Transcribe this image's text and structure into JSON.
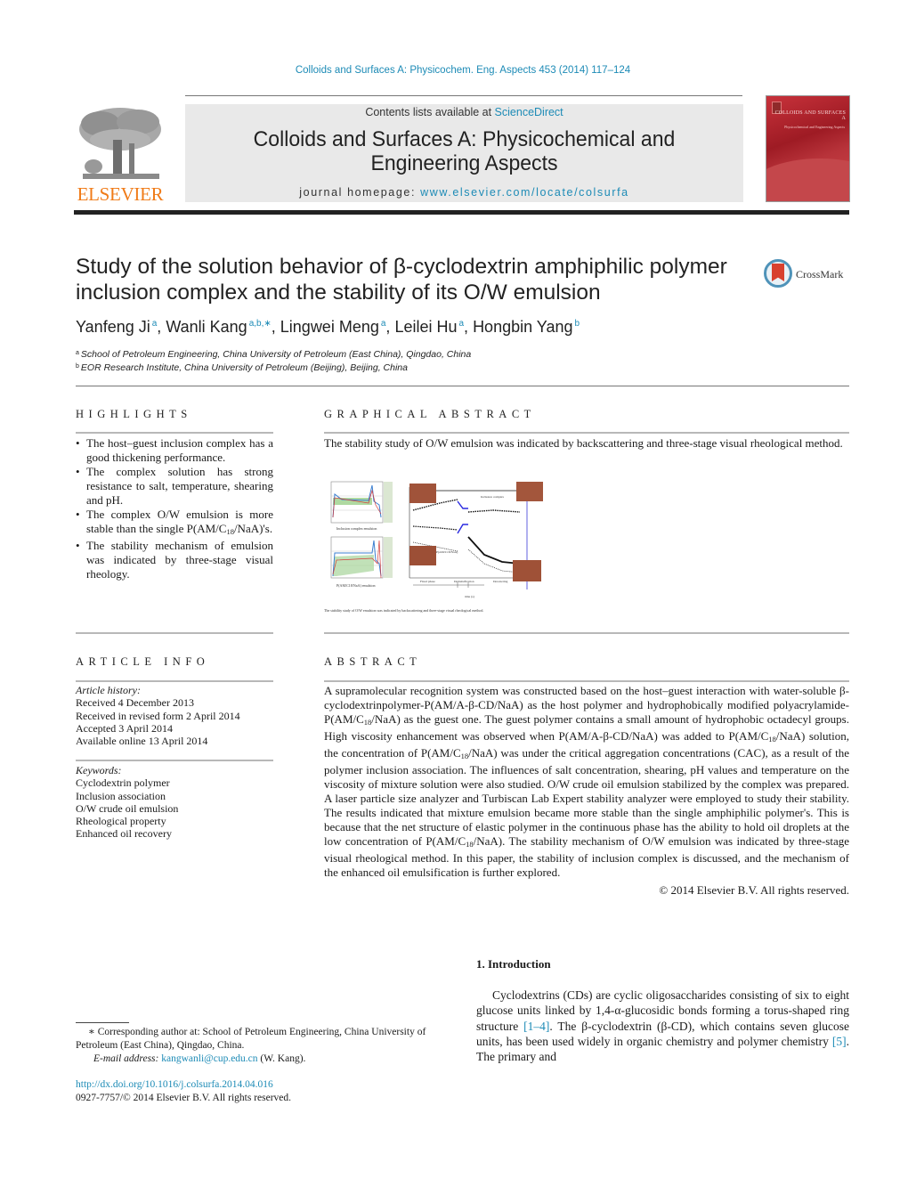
{
  "header": {
    "journal_ref": "Colloids and Surfaces A: Physicochem. Eng. Aspects 453 (2014) 117–124",
    "contents_prefix": "Contents lists available at ",
    "contents_link": "ScienceDirect",
    "journal_title_line1": "Colloids and Surfaces A: Physicochemical and",
    "journal_title_line2": "Engineering Aspects",
    "homepage_prefix": "journal homepage: ",
    "homepage_link": "www.elsevier.com/locate/colsurfa",
    "publisher_logo_text": "ELSEVIER",
    "cover_title": "COLLOIDS AND SURFACES A",
    "cover_subtitle": "Physicochemical and Engineering Aspects"
  },
  "article": {
    "title": "Study of the solution behavior of β-cyclodextrin amphiphilic polymer inclusion complex and the stability of its O/W emulsion",
    "crossmark_label": "CrossMark",
    "authors": [
      {
        "name": "Yanfeng Ji",
        "sup": "a"
      },
      {
        "name": "Wanli Kang",
        "sup": "a,b,∗"
      },
      {
        "name": "Lingwei Meng",
        "sup": "a"
      },
      {
        "name": "Leilei Hu",
        "sup": "a"
      },
      {
        "name": "Hongbin Yang",
        "sup": "b"
      }
    ],
    "affiliations": [
      {
        "sup": "a",
        "text": "School of Petroleum Engineering, China University of Petroleum (East China), Qingdao, China"
      },
      {
        "sup": "b",
        "text": "EOR Research Institute, China University of Petroleum (Beijing), Beijing, China"
      }
    ]
  },
  "highlights": {
    "heading": "HIGHLIGHTS",
    "items": [
      "The host–guest inclusion complex has a good thickening performance.",
      "The complex solution has strong resistance to salt, temperature, shearing and pH.",
      "The complex O/W emulsion is more stable than the single P(AM/C18/NaA)'s.",
      "The stability mechanism of emulsion was indicated by three-stage visual rheology."
    ]
  },
  "graphical_abstract": {
    "heading": "GRAPHICAL ABSTRACT",
    "text": "The stability study of O/W emulsion was indicated by backscattering and three-stage visual rheological method.",
    "figure_labels": {
      "panel_top_caption": "Inclusion complex emulsion",
      "panel_bottom_caption": "P(AM/C18/NaA) emulsion",
      "curve_label_top": "Inclusion complex",
      "curve_label_bottom": "P(AM/C18/NaA)",
      "stage1": "Fixed phase",
      "stage2": "Demulsification",
      "stage3": "Dewatering",
      "x_axis": "time (s)",
      "caption": "The stability study of O/W emulsion was indicated by backscattering and three-stage visual rheological method."
    }
  },
  "article_info": {
    "heading": "ARTICLE INFO",
    "history_label": "Article history:",
    "history": [
      "Received 4 December 2013",
      "Received in revised form 2 April 2014",
      "Accepted 3 April 2014",
      "Available online 13 April 2014"
    ],
    "keywords_label": "Keywords:",
    "keywords": [
      "Cyclodextrin polymer",
      "Inclusion association",
      "O/W crude oil emulsion",
      "Rheological property",
      "Enhanced oil recovery"
    ]
  },
  "abstract": {
    "heading": "ABSTRACT",
    "text": "A supramolecular recognition system was constructed based on the host–guest interaction with water-soluble β-cyclodextrinpolymer-P(AM/A-β-CD/NaA) as the host polymer and hydrophobically modified polyacrylamide-P(AM/C18/NaA) as the guest one. The guest polymer contains a small amount of hydrophobic octadecyl groups. High viscosity enhancement was observed when P(AM/A-β-CD/NaA) was added to P(AM/C18/NaA) solution, the concentration of P(AM/C18/NaA) was under the critical aggregation concentrations (CAC), as a result of the polymer inclusion association. The influences of salt concentration, shearing, pH values and temperature on the viscosity of mixture solution were also studied. O/W crude oil emulsion stabilized by the complex was prepared. A laser particle size analyzer and Turbiscan Lab Expert stability analyzer were employed to study their stability. The results indicated that mixture emulsion became more stable than the single amphiphilic polymer's. This is because that the net structure of elastic polymer in the continuous phase has the ability to hold oil droplets at the low concentration of P(AM/C18/NaA). The stability mechanism of O/W emulsion was indicated by three-stage visual rheological method. In this paper, the stability of inclusion complex is discussed, and the mechanism of the enhanced oil emulsification is further explored.",
    "copyright": "© 2014 Elsevier B.V. All rights reserved."
  },
  "footnote": {
    "marker": "∗",
    "corresponding": "Corresponding author at: School of Petroleum Engineering, China University of Petroleum (East China), Qingdao, China.",
    "email_label": "E-mail address:",
    "email": "kangwanli@cup.edu.cn",
    "email_suffix": "(W. Kang).",
    "doi": "http://dx.doi.org/10.1016/j.colsurfa.2014.04.016",
    "issn_line": "0927-7757/© 2014 Elsevier B.V. All rights reserved."
  },
  "introduction": {
    "heading": "1.  Introduction",
    "p1_a": "Cyclodextrins (CDs) are cyclic oligosaccharides consisting of six to eight glucose units linked by 1,4-α-glucosidic bonds forming a torus-shaped ring structure ",
    "ref1": "[1–4]",
    "p1_b": ". The β-cyclodextrin (β-CD), which contains seven glucose units, has been used widely in organic chemistry and polymer chemistry ",
    "ref2": "[5]",
    "p1_c": ". The primary and"
  },
  "colors": {
    "link": "#1d8bb6",
    "elsevier_orange": "#f07b18",
    "banner_gray": "#e9e9e9"
  }
}
